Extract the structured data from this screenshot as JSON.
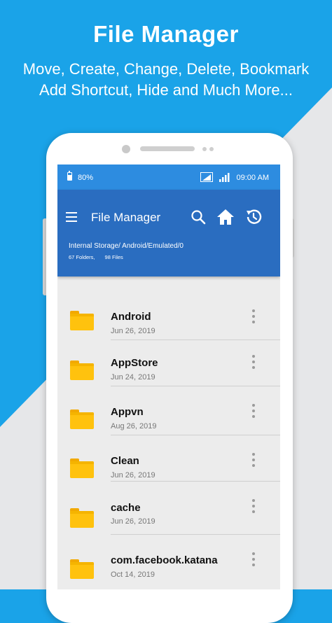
{
  "promo": {
    "title": "File Manager",
    "subtitle_line1": "Move, Create, Change, Delete, Bookmark",
    "subtitle_line2": "Add Shortcut, Hide and Much More..."
  },
  "status_bar": {
    "battery": "80%",
    "time": "09:00 AM"
  },
  "app_bar": {
    "title": "File Manager",
    "path": "Internal Storage/ Android/Emulated/0",
    "folders_count": "67 Folders,",
    "files_count": "98 Files",
    "icons": [
      "menu-icon",
      "search-icon",
      "home-icon",
      "history-icon"
    ]
  },
  "files": [
    {
      "name": "Android",
      "date": "Jun 26,  2019"
    },
    {
      "name": "AppStore",
      "date": "Jun 24,  2019"
    },
    {
      "name": "Appvn",
      "date": "Aug 26,  2019"
    },
    {
      "name": "Clean",
      "date": "Jun 26,  2019"
    },
    {
      "name": "cache",
      "date": "Jun 26,  2019"
    },
    {
      "name": "com.facebook.katana",
      "date": "Oct 14,  2019"
    }
  ],
  "colors": {
    "background_blue": "#1aa3e8",
    "status_bar": "#2d8ce0",
    "app_bar": "#2a6dc0",
    "folder": "#ffc20e"
  }
}
